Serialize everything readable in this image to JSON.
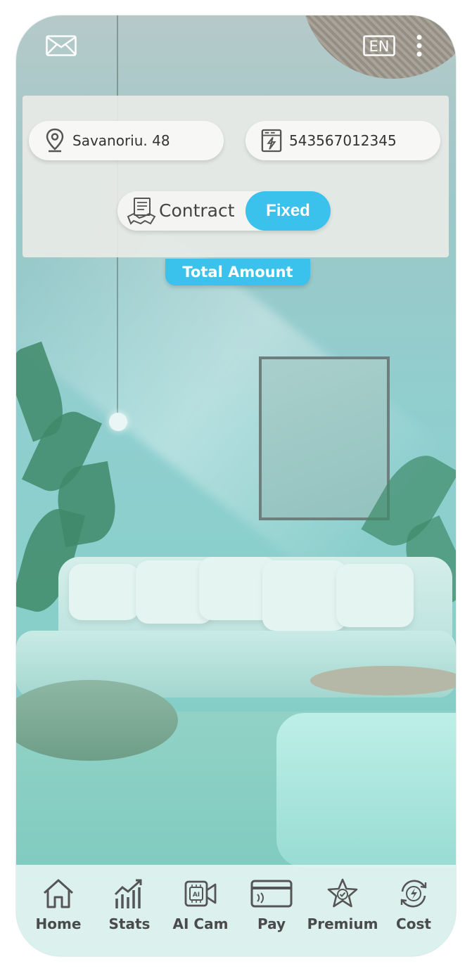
{
  "header": {
    "mail_icon": "mail-icon",
    "language": "EN",
    "more_icon": "more-vertical-icon"
  },
  "info_card": {
    "address": "Savanoriu. 48",
    "meter_number": "543567012345",
    "contract_label": "Contract",
    "contract_type": "Fixed"
  },
  "total_amount_label": "Total Amount",
  "nav": {
    "items": [
      {
        "label": "Home",
        "icon": "home-icon"
      },
      {
        "label": "Stats",
        "icon": "stats-icon"
      },
      {
        "label": "AI Cam",
        "icon": "ai-camera-icon"
      },
      {
        "label": "Pay",
        "icon": "card-icon"
      },
      {
        "label": "Premium",
        "icon": "star-badge-icon"
      },
      {
        "label": "Cost",
        "icon": "energy-cost-icon"
      }
    ]
  },
  "colors": {
    "accent": "#3bc2ec",
    "card_bg": "#e8eae6",
    "nav_text": "#4a4a4a"
  }
}
